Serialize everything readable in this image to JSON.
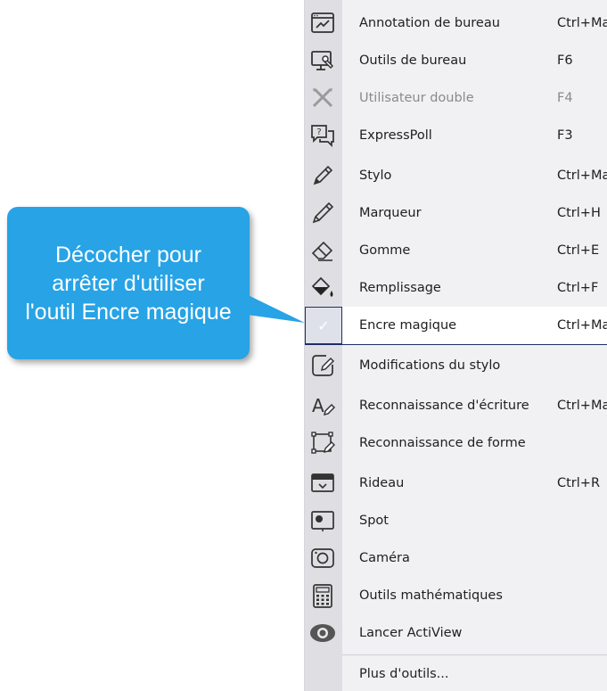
{
  "menu": {
    "items": [
      {
        "label": "Annotation de bureau",
        "shortcut": "Ctrl+Maj",
        "icon": "desktop-annotation-icon",
        "enabled": true
      },
      {
        "label": "Outils de bureau",
        "shortcut": "F6",
        "icon": "desktop-tools-icon",
        "enabled": true
      },
      {
        "label": "Utilisateur double",
        "shortcut": "F4",
        "icon": "dual-user-icon",
        "enabled": false
      },
      {
        "label": "ExpressPoll",
        "shortcut": "F3",
        "icon": "expresspoll-icon",
        "enabled": true
      },
      {
        "label": "Stylo",
        "shortcut": "Ctrl+Maj",
        "icon": "pen-icon",
        "enabled": true
      },
      {
        "label": "Marqueur",
        "shortcut": "Ctrl+H",
        "icon": "highlighter-icon",
        "enabled": true
      },
      {
        "label": "Gomme",
        "shortcut": "Ctrl+E",
        "icon": "eraser-icon",
        "enabled": true
      },
      {
        "label": "Remplissage",
        "shortcut": "Ctrl+F",
        "icon": "fill-icon",
        "enabled": true
      },
      {
        "label": "Encre magique",
        "shortcut": "Ctrl+Maj",
        "icon": "checkmark-icon",
        "enabled": true,
        "checked": true
      },
      {
        "label": "Modifications du stylo",
        "shortcut": "",
        "icon": "pen-modifications-icon",
        "enabled": true
      },
      {
        "label": "Reconnaissance d'écriture",
        "shortcut": "Ctrl+Maj",
        "icon": "handwriting-recognition-icon",
        "enabled": true
      },
      {
        "label": "Reconnaissance de forme",
        "shortcut": "",
        "icon": "shape-recognition-icon",
        "enabled": true
      },
      {
        "label": "Rideau",
        "shortcut": "Ctrl+R",
        "icon": "curtain-icon",
        "enabled": true
      },
      {
        "label": "Spot",
        "shortcut": "",
        "icon": "spotlight-icon",
        "enabled": true
      },
      {
        "label": "Caméra",
        "shortcut": "",
        "icon": "camera-icon",
        "enabled": true
      },
      {
        "label": "Outils mathématiques",
        "shortcut": "",
        "icon": "calculator-icon",
        "enabled": true
      },
      {
        "label": "Lancer ActiView",
        "shortcut": "",
        "icon": "eye-icon",
        "enabled": true
      },
      {
        "label": "Plus d'outils...",
        "shortcut": "",
        "icon": "",
        "enabled": true
      }
    ]
  },
  "callout": {
    "text": "Décocher pour arrêter d'utiliser l'outil Encre magique",
    "color": "#27a3e6"
  },
  "colors": {
    "menu_bg": "#f1f1f3",
    "gutter_bg": "#dfdfe3",
    "active_border": "#1d2d6b"
  }
}
